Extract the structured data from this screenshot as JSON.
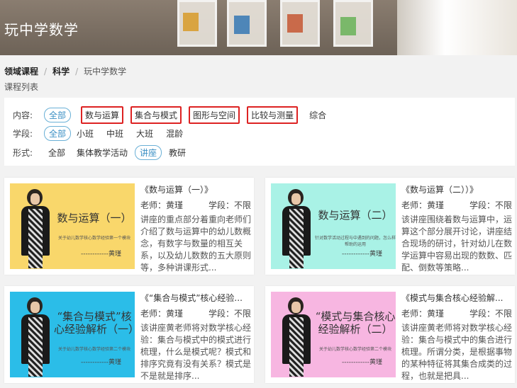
{
  "banner": {
    "title": "玩中学数学"
  },
  "breadcrumb": {
    "home": "领域课程",
    "section": "科学",
    "current": "玩中学数学"
  },
  "list_label": "课程列表",
  "filters": {
    "content": {
      "label": "内容:",
      "options": [
        "全部",
        "数与运算",
        "集合与模式",
        "图形与空间",
        "比较与测量",
        "综合"
      ]
    },
    "grade": {
      "label": "学段:",
      "options": [
        "全部",
        "小班",
        "中班",
        "大班",
        "混龄"
      ]
    },
    "format": {
      "label": "形式:",
      "options": [
        "全部",
        "集体教学活动",
        "讲座",
        "教研"
      ]
    }
  },
  "cards": [
    {
      "thumb_title": "数与运算（一）",
      "thumb_sub": "关于幼儿数学核心数学经验第一个模块",
      "thumb_author": "------------黄瑾",
      "title": "《数与运算（一）》",
      "teacher": "老师：黄瑾",
      "grade": "学段：不限",
      "desc": "讲座的重点部分着重向老师们介绍了数与运算中的幼儿数概念，有数字与数量的相互关系，以及幼儿数数的五大原则等，多种讲课形式..."
    },
    {
      "thumb_title": "数与运算（二）",
      "thumb_sub": "针对数学活动过程与中遇到的问题，怎么样帮助的运用",
      "thumb_author": "------------黄瑾",
      "title": "《数与运算（二））》",
      "teacher": "老师：黄瑾",
      "grade": "学段：不限",
      "desc": "该讲座围绕着数与运算中，运算这个部分展开讨论，讲座结合现场的研讨，针对幼儿在数学运算中容易出现的数数、匹配、倒数等策略..."
    },
    {
      "thumb_title": "“集合与模式”核心经验解析（一）",
      "thumb_sub": "关于幼儿数学核心数学经验第二个模块",
      "thumb_author": "------------黄瑾",
      "title": "《“集合与模式”核心经验...",
      "teacher": "老师：黄瑾",
      "grade": "学段：不限",
      "desc": "该讲座黄老师将对数学核心经验：集合与模式中的模式进行梳理，什么是模式呢？模式和排序究竟有没有关系？模式是不是就是排序..."
    },
    {
      "thumb_title": "“模式与集合核心经验解析（二）",
      "thumb_sub": "关于幼儿数学核心数学经验第二个模块",
      "thumb_author": "------------黄瑾",
      "title": "《模式与集合核心经验解...",
      "teacher": "老师：黄瑾",
      "grade": "学段：不限",
      "desc": "该讲座黄老师将对数学核心经验：集合与模式中的集合进行梳理。所谓分类，是根据事物的某种特征将其集合成类的过程，也就是把具..."
    }
  ],
  "colors": {
    "accent": "#3a8fc4",
    "highlight_box": "#dd2222",
    "thumb_bgs": [
      "#f9d76b",
      "#a9f2e6",
      "#2bbde8",
      "#f7b6e1"
    ]
  }
}
